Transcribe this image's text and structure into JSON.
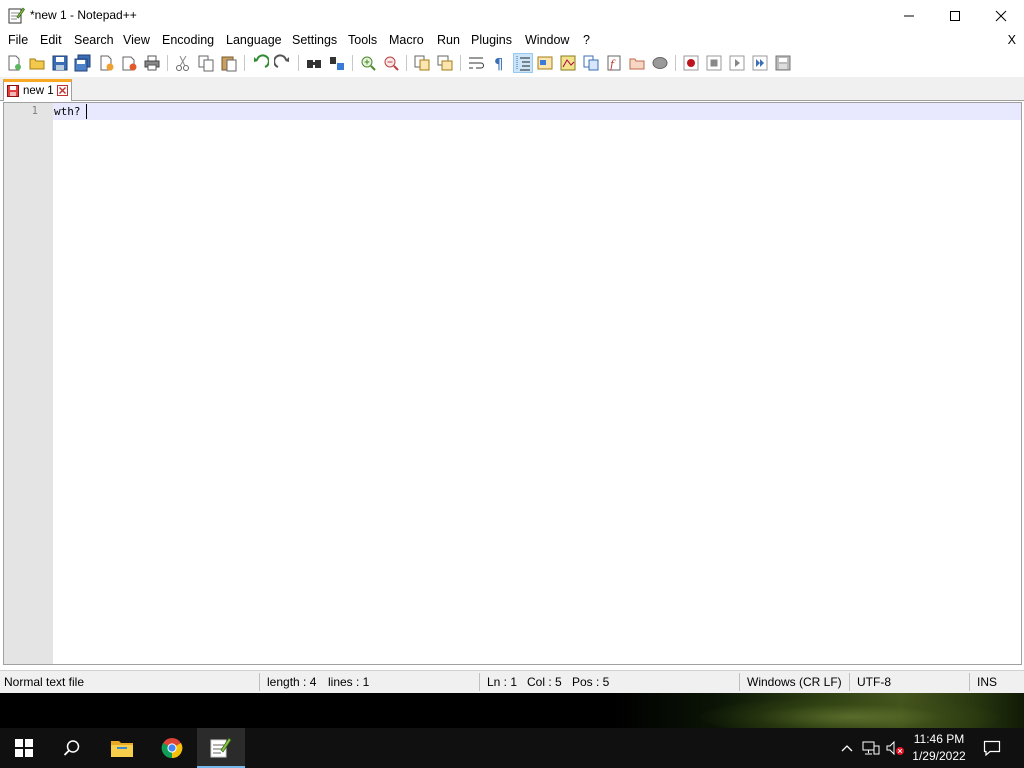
{
  "window": {
    "title": "*new 1 - Notepad++"
  },
  "menu": {
    "items": [
      {
        "label": "File"
      },
      {
        "label": "Edit"
      },
      {
        "label": "Search"
      },
      {
        "label": "View"
      },
      {
        "label": "Encoding"
      },
      {
        "label": "Language"
      },
      {
        "label": "Settings"
      },
      {
        "label": "Tools"
      },
      {
        "label": "Macro"
      },
      {
        "label": "Run"
      },
      {
        "label": "Plugins"
      },
      {
        "label": "Window"
      },
      {
        "label": "?"
      }
    ],
    "close_label": "X"
  },
  "toolbar": {
    "icons": [
      "new-file-icon",
      "open-file-icon",
      "save-icon",
      "save-all-icon",
      "close-icon",
      "close-all-icon",
      "print-icon",
      "cut-icon",
      "copy-icon",
      "paste-icon",
      "undo-icon",
      "redo-icon",
      "find-icon",
      "replace-icon",
      "zoom-in-icon",
      "zoom-out-icon",
      "sync-vertical-icon",
      "sync-horizontal-icon",
      "word-wrap-icon",
      "show-all-characters-icon",
      "indent-guide-icon",
      "define-language-icon",
      "document-map-icon",
      "document-list-icon",
      "function-list-icon",
      "folder-as-workspace-icon",
      "monitoring-icon",
      "record-macro-icon",
      "stop-recording-icon",
      "playback-macro-icon",
      "run-macro-multiple-icon",
      "save-macro-icon"
    ]
  },
  "tabs": [
    {
      "label": "new 1",
      "modified": true
    }
  ],
  "editor": {
    "lines": [
      {
        "number": "1",
        "text": "wth?"
      }
    ],
    "current_line_color": "#e8e8ff"
  },
  "status": {
    "file_type": "Normal text file",
    "length": "length : 4",
    "lines": "lines : 1",
    "ln": "Ln : 1",
    "col": "Col : 5",
    "pos": "Pos : 5",
    "eol": "Windows (CR LF)",
    "encoding": "UTF-8",
    "mode": "INS"
  },
  "taskbar": {
    "apps": [
      "windows-start-icon",
      "search-icon",
      "file-explorer-icon",
      "chrome-icon",
      "notepad-plus-plus-icon"
    ],
    "clock": {
      "time": "11:46 PM",
      "date": "1/29/2022"
    }
  },
  "colors": {
    "accent": "#76b9ed",
    "tab_marker": "#f9a825",
    "taskbar": "#101010"
  }
}
